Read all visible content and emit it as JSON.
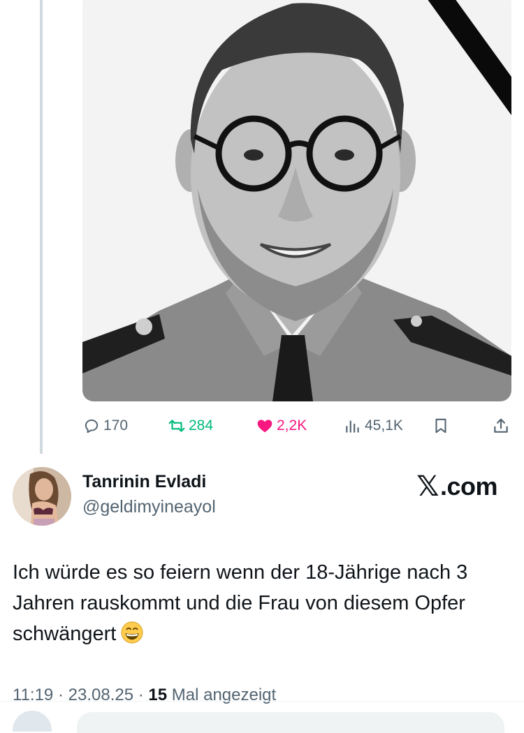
{
  "post": {
    "stats": {
      "replies": "170",
      "reposts": "284",
      "likes": "2,2K",
      "views": "45,1K"
    }
  },
  "reply": {
    "display_name": "Tanrinin Evladi",
    "handle": "@geldimyineayol",
    "brand": ".com",
    "text": "Ich würde es so feiern wenn der 18-Jährige nach 3 Jahren rauskommt und die Frau von diesem Opfer schwängert",
    "meta": {
      "time": "11:19",
      "date": "23.08.25",
      "views_count": "15",
      "views_label": "Mal angezeigt"
    }
  },
  "icons": {
    "reply": "reply-icon",
    "repost": "repost-icon",
    "like": "heart-icon",
    "views": "views-icon",
    "bookmark": "bookmark-icon",
    "share": "share-icon",
    "emoji": "grinning-face-emoji"
  },
  "colors": {
    "repost_active": "#00ba7c",
    "like_active": "#f91880",
    "muted_text": "#536471",
    "primary_text": "#0f1419"
  }
}
